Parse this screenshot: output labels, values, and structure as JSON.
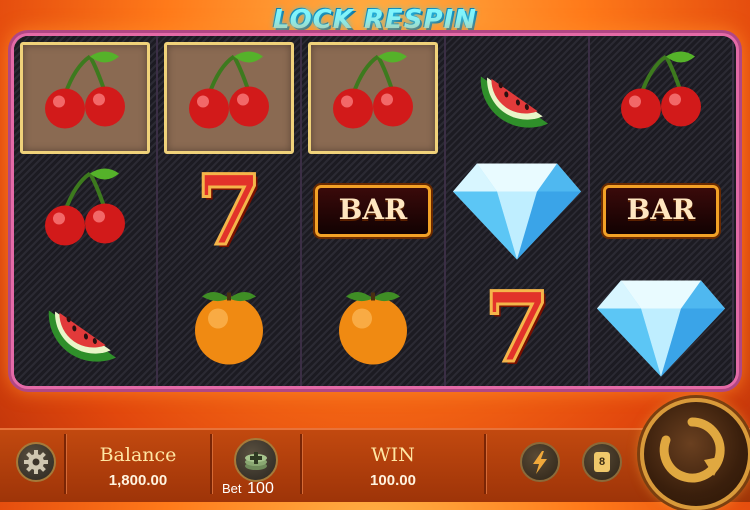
{
  "title": "LOCK RESPIN",
  "reels": [
    [
      {
        "symbol": "cherry",
        "locked": true
      },
      {
        "symbol": "cherry",
        "locked": false
      },
      {
        "symbol": "watermelon",
        "locked": false
      }
    ],
    [
      {
        "symbol": "cherry",
        "locked": true
      },
      {
        "symbol": "seven",
        "locked": false
      },
      {
        "symbol": "orange",
        "locked": false
      }
    ],
    [
      {
        "symbol": "cherry",
        "locked": true
      },
      {
        "symbol": "bar",
        "locked": false
      },
      {
        "symbol": "orange",
        "locked": false
      }
    ],
    [
      {
        "symbol": "watermelon",
        "locked": false
      },
      {
        "symbol": "diamond",
        "locked": false
      },
      {
        "symbol": "seven",
        "locked": false
      }
    ],
    [
      {
        "symbol": "cherry",
        "locked": false
      },
      {
        "symbol": "bar",
        "locked": false
      },
      {
        "symbol": "diamond",
        "locked": false
      }
    ]
  ],
  "symbols": {
    "bar_text": "BAR",
    "seven_text": "7"
  },
  "bottom": {
    "balance_label": "Balance",
    "balance_value": "1,800.00",
    "bet_label": "Bet",
    "bet_value": "100",
    "win_label": "WIN",
    "win_value": "100.00",
    "auto_count": "8"
  },
  "icons": {
    "settings": "gear-icon",
    "bet": "chips-plus-icon",
    "turbo": "lightning-icon",
    "auto": "auto-count-icon",
    "spin": "spin-arrow-icon"
  },
  "colors": {
    "accent": "#7ff6ff",
    "frame": "#e46aa7",
    "lock_border": "#f0d27a",
    "bottom_bar": "#b4400c"
  }
}
